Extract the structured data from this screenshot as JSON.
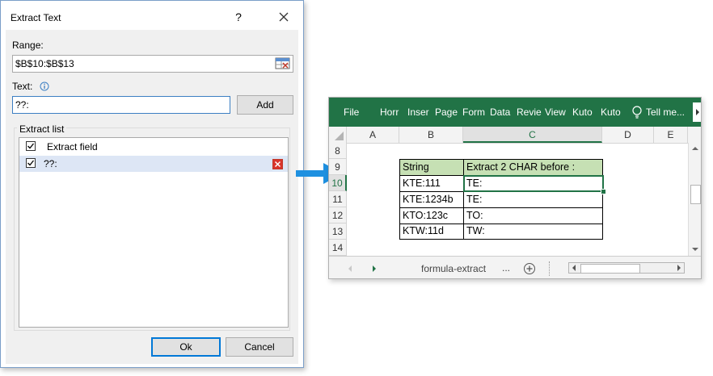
{
  "dialog": {
    "title": "Extract Text",
    "help": "?",
    "range_label": "Range:",
    "range_value": "$B$10:$B$13",
    "text_label": "Text:",
    "text_value": "??:",
    "add_label": "Add",
    "extract_list_label": "Extract list",
    "list": [
      {
        "label": "Extract field",
        "checked": true
      },
      {
        "label": "??:",
        "checked": true
      }
    ],
    "ok_label": "Ok",
    "cancel_label": "Cancel"
  },
  "excel": {
    "tabs": [
      "File",
      "Horr",
      "Inser",
      "Page",
      "Form",
      "Data",
      "Revie",
      "View",
      "Kuto",
      "Kuto",
      "Tell me..."
    ],
    "columns": [
      "A",
      "B",
      "C",
      "D",
      "E"
    ],
    "rows": [
      "8",
      "9",
      "10",
      "11",
      "12",
      "13",
      "14"
    ],
    "table_header": [
      "String",
      "Extract 2 CHAR before :"
    ],
    "table_rows": [
      [
        "KTE:111",
        "TE:"
      ],
      [
        "KTE:1234b",
        "TE:"
      ],
      [
        "KTO:123c",
        "TO:"
      ],
      [
        "KTW:11d",
        "TW:"
      ]
    ],
    "sheet_name": "formula-extract",
    "sheet_more": "...",
    "colors": {
      "ribbon": "#217346",
      "header_fill": "#c6e0b4",
      "arrow": "#1e90e0"
    }
  }
}
